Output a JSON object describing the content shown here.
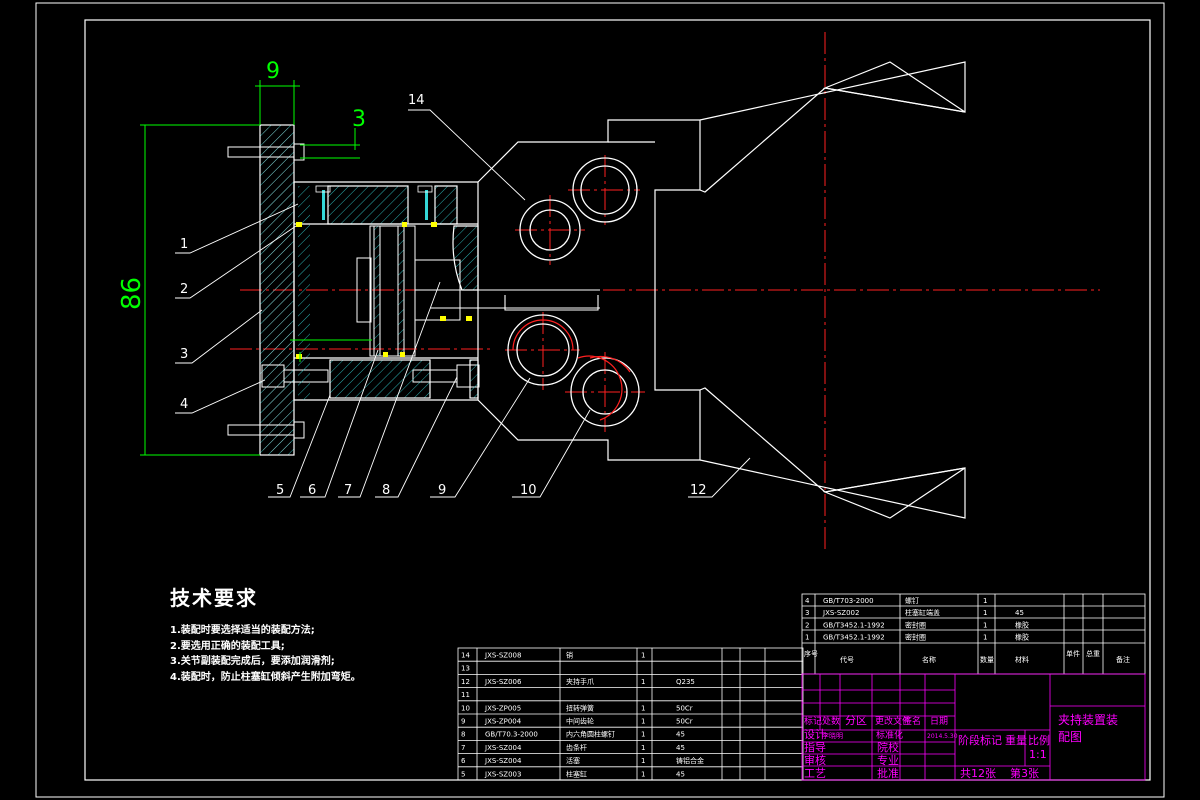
{
  "colors": {
    "background": "#000000",
    "line": "#ffffff",
    "center_line": "#ff2020",
    "dimension": "#00ff00",
    "title_block": "#ff00ff",
    "hatch": "#ffff00"
  },
  "dimensions": {
    "d9": "9",
    "d3": "3",
    "d86": "86"
  },
  "callouts": [
    "1",
    "2",
    "3",
    "4",
    "5",
    "6",
    "7",
    "8",
    "9",
    "10",
    "12",
    "14"
  ],
  "tech_req": {
    "title": "技术要求",
    "lines": [
      "1.装配时要选择适当的装配方法;",
      "2.要选用正确的装配工具;",
      "3.关节副装配完成后，要添加润滑剂;",
      "4.装配时，防止柱塞缸倾斜产生附加弯矩。"
    ]
  },
  "parts_upper": [
    {
      "no": "4",
      "code": "GB/T703-2000",
      "name": "螺钉",
      "qty": "1",
      "mat": ""
    },
    {
      "no": "3",
      "code": "JXS-SZ002",
      "name": "柱塞缸端盖",
      "qty": "1",
      "mat": "45"
    },
    {
      "no": "2",
      "code": "GB/T3452.1-1992",
      "name": "密封圈",
      "qty": "1",
      "mat": "橡胶"
    },
    {
      "no": "1",
      "code": "GB/T3452.1-1992",
      "name": "密封圈",
      "qty": "1",
      "mat": "橡胶"
    }
  ],
  "parts_upper_header": {
    "no": "序号",
    "code": "代号",
    "name": "名称",
    "qty": "数量",
    "mat": "材料",
    "unit": "单件",
    "total": "总重",
    "remark": "备注"
  },
  "parts_lower": [
    {
      "no": "14",
      "code": "JXS-SZ008",
      "name": "销",
      "qty": "1",
      "mat": ""
    },
    {
      "no": "13",
      "code": "",
      "name": "",
      "qty": "",
      "mat": ""
    },
    {
      "no": "12",
      "code": "JXS-SZ006",
      "name": "夹持手爪",
      "qty": "1",
      "mat": "Q235"
    },
    {
      "no": "11",
      "code": "",
      "name": "",
      "qty": "",
      "mat": ""
    },
    {
      "no": "10",
      "code": "JXS-ZP005",
      "name": "扭转弹簧",
      "qty": "1",
      "mat": "50Cr"
    },
    {
      "no": "9",
      "code": "JXS-ZP004",
      "name": "中间齿轮",
      "qty": "1",
      "mat": "50Cr"
    },
    {
      "no": "8",
      "code": "GB/T70.3-2000",
      "name": "内六角圆柱螺钉",
      "qty": "1",
      "mat": "45"
    },
    {
      "no": "7",
      "code": "JXS-SZ004",
      "name": "齿条杆",
      "qty": "1",
      "mat": "45"
    },
    {
      "no": "6",
      "code": "JXS-SZ004",
      "name": "活塞",
      "qty": "1",
      "mat": "铸铝合金"
    },
    {
      "no": "5",
      "code": "JXS-SZ003",
      "name": "柱塞缸",
      "qty": "1",
      "mat": "45"
    }
  ],
  "title_block": {
    "row_labels": [
      "标记",
      "处数",
      "分区",
      "更改文件",
      "签名",
      "日期"
    ],
    "design": "设计",
    "design_name": "李晓明",
    "std": "标准化",
    "std_date": "2014.5.30",
    "check": "指导",
    "review": "审核",
    "process": "工艺",
    "approve": "批准",
    "school": "院校",
    "major": "专业",
    "stage": "阶段标记",
    "weight": "重量",
    "scale_label": "比例",
    "scale": "1:1",
    "sheets": "共12张",
    "sheet": "第3张",
    "drawing_title": "夹持装置装配图"
  }
}
